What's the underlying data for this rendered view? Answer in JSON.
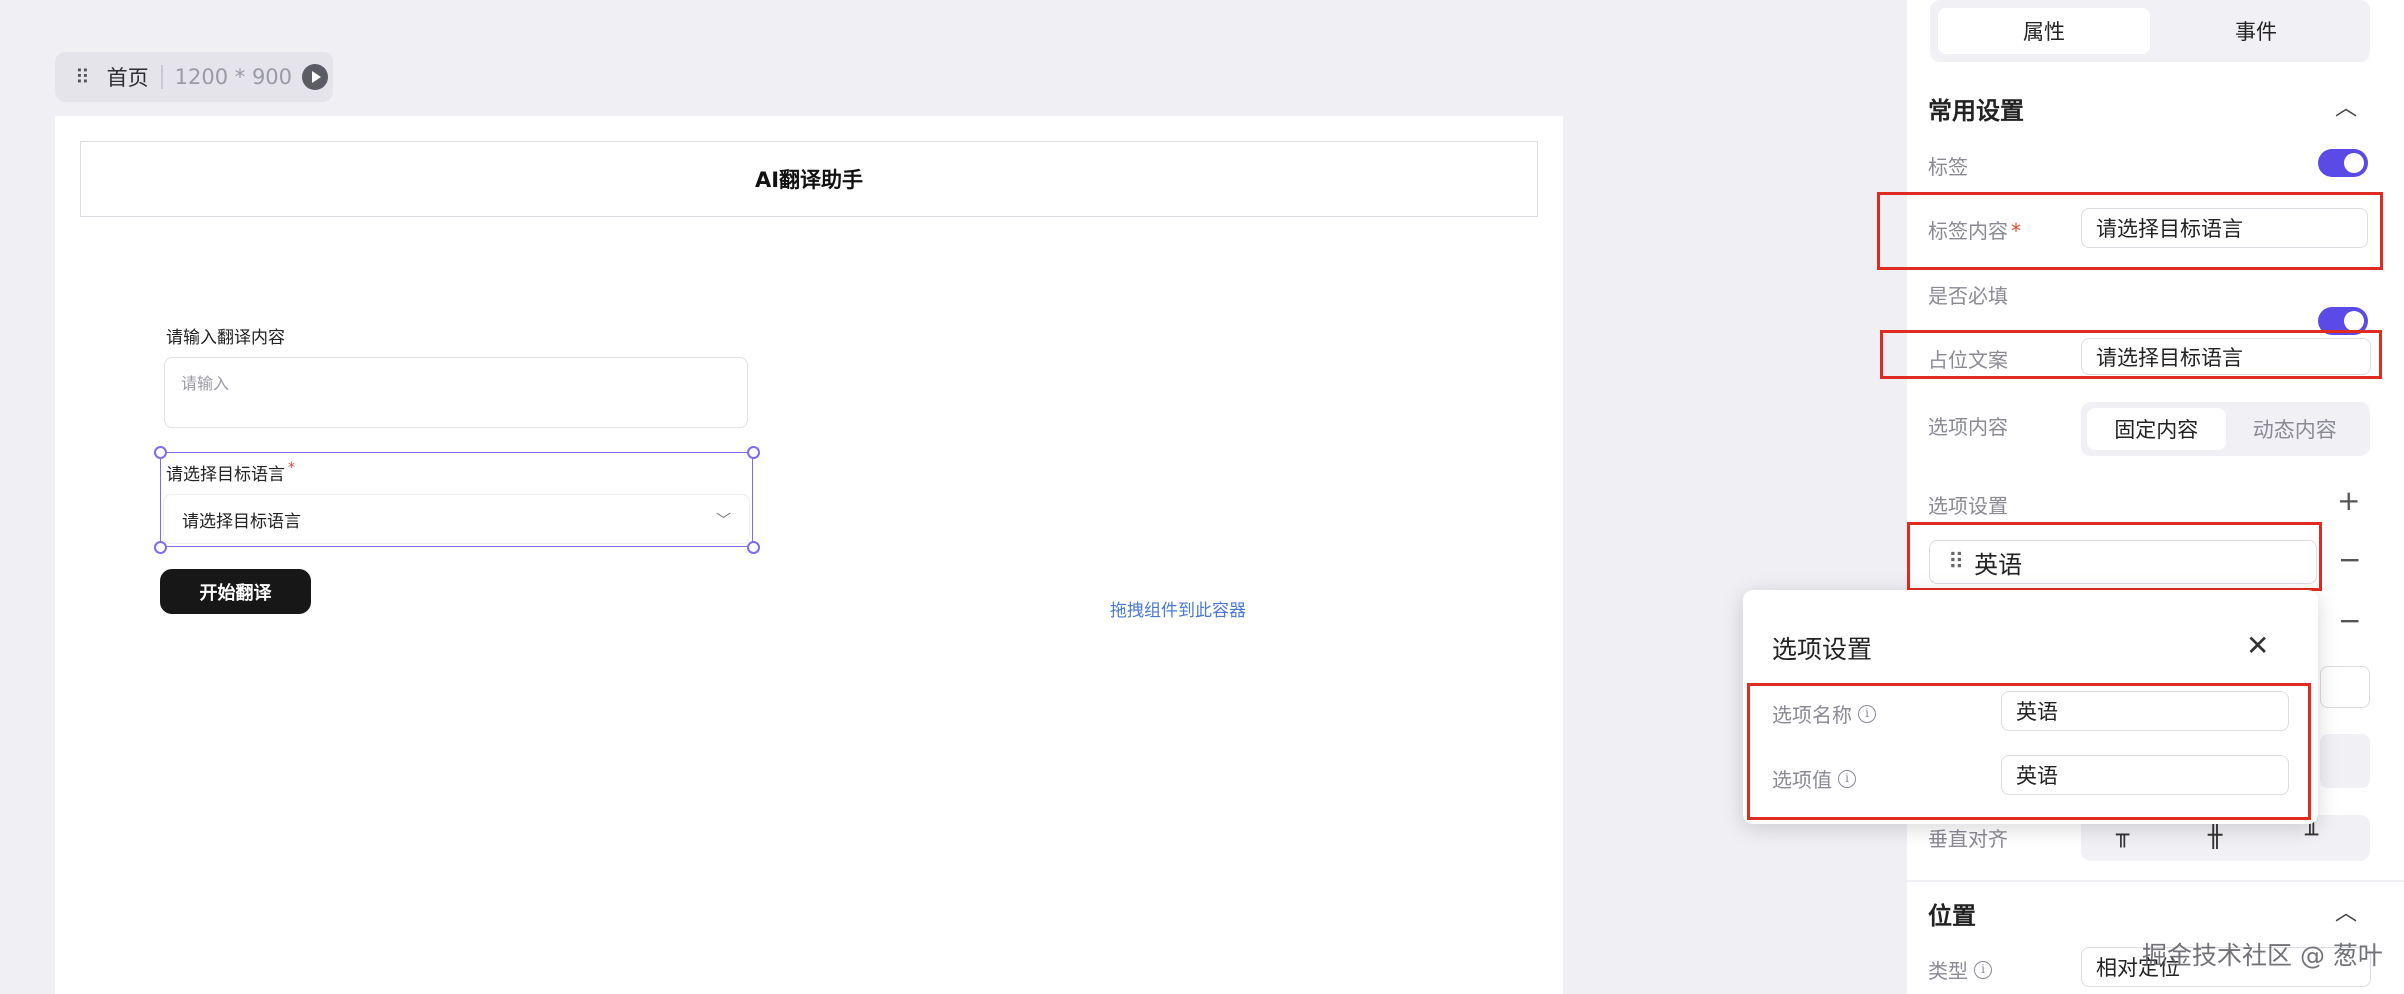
{
  "toolbar": {
    "page_name": "首页",
    "size": "1200 * 900"
  },
  "app": {
    "title": "AI翻译助手"
  },
  "form": {
    "input_label": "请输入翻译内容",
    "input_placeholder": "请输入",
    "select_label": "请选择目标语言",
    "select_placeholder": "请选择目标语言",
    "start_button": "开始翻译",
    "drop_hint": "拖拽组件到此容器"
  },
  "panel": {
    "tabs": [
      {
        "label": "属性",
        "active": true
      },
      {
        "label": "事件",
        "active": false
      }
    ],
    "common_section": "常用设置",
    "label_toggle": "标签",
    "label_content_label": "标签内容",
    "label_content_value": "请选择目标语言",
    "required_label": "是否必填",
    "placeholder_label": "占位文案",
    "placeholder_value": "请选择目标语言",
    "options_content_label": "选项内容",
    "options_mode": [
      "固定内容",
      "动态内容"
    ],
    "options_settings_label": "选项设置",
    "option_item": "英语",
    "vertical_align_label": "垂直对齐",
    "position_section": "位置",
    "type_label": "类型",
    "type_value": "相对定位"
  },
  "modal": {
    "title": "选项设置",
    "name_label": "选项名称",
    "name_value": "英语",
    "value_label": "选项值",
    "value_value": "英语"
  },
  "watermark": "掘金技术社区 @ 葱叶",
  "colors": {
    "accent": "#5b4be6",
    "highlight": "#e02b20",
    "button": "#171717",
    "link": "#4a78d6"
  }
}
